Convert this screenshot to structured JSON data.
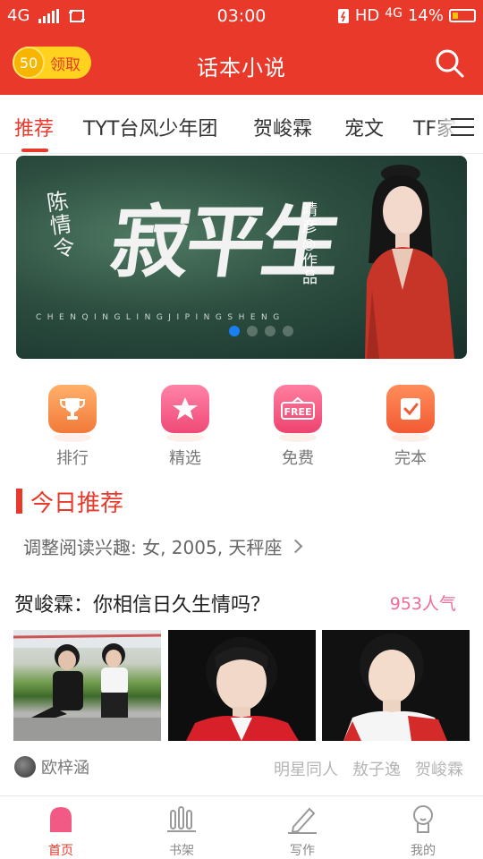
{
  "status_bar": {
    "network": "4G",
    "time": "03:00",
    "hd": "HD",
    "net2": "4G",
    "battery": "14%"
  },
  "header": {
    "coins": "50",
    "claim_label": "领取",
    "title": "话本小说"
  },
  "tabs": [
    {
      "label": "推荐",
      "active": true
    },
    {
      "label": "TYT台风少年团",
      "active": false
    },
    {
      "label": "贺峻霖",
      "active": false
    },
    {
      "label": "宠文",
      "active": false
    },
    {
      "label": "TF家",
      "active": false
    }
  ],
  "banner": {
    "title_small": "陈情令",
    "title_big": "寂平生",
    "author_text": "晴彦◎作品",
    "pinyin": "CHENQINGLINGJIPINGSHENG",
    "dots": 4,
    "active_dot": 0
  },
  "quick_nav": [
    {
      "label": "排行",
      "icon": "trophy-icon",
      "color": "#f5894a"
    },
    {
      "label": "精选",
      "icon": "star-icon",
      "color": "#f25a86"
    },
    {
      "label": "免费",
      "icon": "free-tag-icon",
      "color": "#f2557d",
      "badge": "FREE"
    },
    {
      "label": "完本",
      "icon": "check-book-icon",
      "color": "#f5643c"
    }
  ],
  "section": {
    "title": "今日推荐",
    "interest_text": "调整阅读兴趣: 女, 2005, 天秤座"
  },
  "story": {
    "title": "贺峻霖：你相信日久生情吗？",
    "popularity": "953人气",
    "author": "欧梓涵",
    "tags": [
      "明星同人",
      "敖子逸",
      "贺峻霖"
    ]
  },
  "bottom_nav": [
    {
      "label": "首页",
      "icon": "home-icon",
      "active": true
    },
    {
      "label": "书架",
      "icon": "bookshelf-icon",
      "active": false
    },
    {
      "label": "写作",
      "icon": "pen-icon",
      "active": false
    },
    {
      "label": "我的",
      "icon": "profile-icon",
      "active": false
    }
  ],
  "colors": {
    "brand_red": "#e8392b",
    "coin_yellow": "#ffd21f",
    "popularity_pink": "#ee6b9b"
  }
}
